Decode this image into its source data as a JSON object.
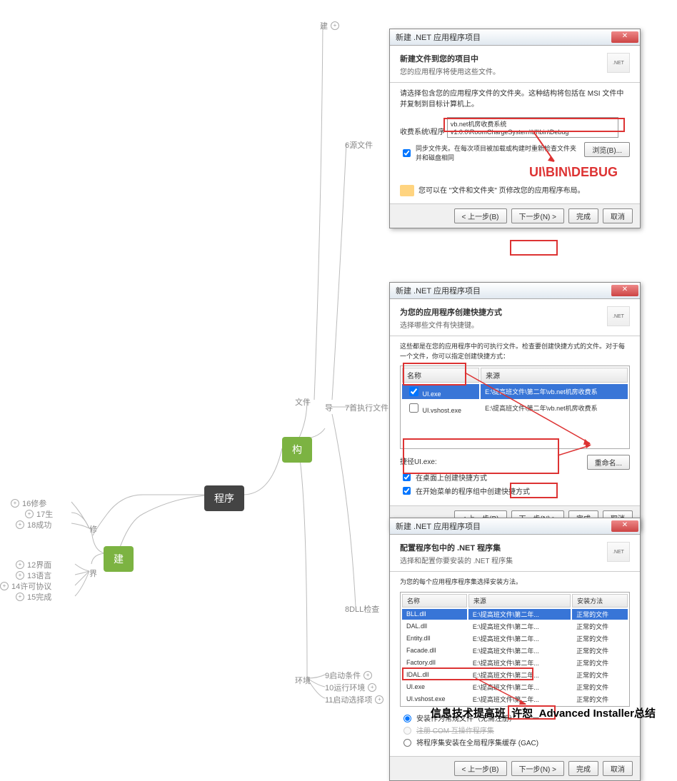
{
  "mind": {
    "root": "程序",
    "build": "建",
    "gou": "构",
    "wenjing": "文件",
    "dao": "导",
    "huanjing": "环境",
    "xiu": "修",
    "jie": "界",
    "jian": "建",
    "n6": "6源文件",
    "n7": "7首执行文件",
    "n8": "8DLL检查",
    "n9": "9启动条件",
    "n10": "10运行环境",
    "n11": "11启动选择项",
    "n12": "12界面",
    "n13": "13语言",
    "n14": "14许可协议",
    "n15": "15完成",
    "n16": "16修参",
    "n17": "17生",
    "n18": "18成功",
    "top_jian": "建"
  },
  "dlg1": {
    "title": "新建 .NET 应用程序项目",
    "head": "新建文件到您的项目中",
    "sub": "您的应用程序将使用这些文件。",
    "info": "请选择包含您的应用程序文件的文件夹。这种结构将包括在 MSI 文件中并复制到目标计算机上。",
    "label": "收费系统\\程序",
    "path": "vb.net机房收费系统v1.0.0\\RoomChargeSystem\\UI\\bin\\Debug",
    "sync": "同步文件夹。在每次项目被加载或构建时重新检查文件夹并和磁盘相同",
    "browse": "浏览(B)...",
    "tip": "您可以在 \"文件和文件夹\" 页修改您的应用程序布局。",
    "red": "UI\\BIN\\DEBUG",
    "back": "< 上一步(B)",
    "next": "下一步(N) >",
    "finish": "完成",
    "cancel": "取消"
  },
  "dlg2": {
    "title": "新建 .NET 应用程序项目",
    "head": "为您的应用程序创建快捷方式",
    "sub": "选择哪些文件有快捷键。",
    "info": "这些都是在您的应用程序中的可执行文件。检查要创建快捷方式的文件。对于每一个文件，你可以指定创建快捷方式：",
    "col1": "名称",
    "col2": "来源",
    "r1": {
      "n": "UI.exe",
      "s": "E:\\提高班文件\\第二年\\vb.net机房收费系"
    },
    "r2": {
      "n": "UI.vshost.exe",
      "s": "E:\\提高班文件\\第二年\\vb.net机房收费系"
    },
    "shortcut": "捷径UI.exe:",
    "rename": "重命名...",
    "c1": "在桌面上创建快捷方式",
    "c2": "在开始菜单的程序组中创建快捷方式",
    "back": "< 上一步(B)",
    "next": "下一步(N) >",
    "finish": "完成",
    "cancel": "取消"
  },
  "dlg3": {
    "title": "新建 .NET 应用程序项目",
    "head": "配置程序包中的 .NET 程序集",
    "sub": "选择和配置你要安装的 .NET 程序集",
    "info": "为您的每个应用程序程序集选择安装方法。",
    "col1": "名称",
    "col2": "来源",
    "col3": "安装方法",
    "rows": [
      {
        "n": "BLL.dll",
        "s": "E:\\提高班文件\\第二年...",
        "m": "正常的文件"
      },
      {
        "n": "DAL.dll",
        "s": "E:\\提高班文件\\第二年...",
        "m": "正常的文件"
      },
      {
        "n": "Entity.dll",
        "s": "E:\\提高班文件\\第二年...",
        "m": "正常的文件"
      },
      {
        "n": "Facade.dll",
        "s": "E:\\提高班文件\\第二年...",
        "m": "正常的文件"
      },
      {
        "n": "Factory.dll",
        "s": "E:\\提高班文件\\第二年...",
        "m": "正常的文件"
      },
      {
        "n": "IDAL.dll",
        "s": "E:\\提高班文件\\第二年...",
        "m": "正常的文件"
      },
      {
        "n": "UI.exe",
        "s": "E:\\提高班文件\\第二年...",
        "m": "正常的文件"
      },
      {
        "n": "UI.vshost.exe",
        "s": "E:\\提高班文件\\第二年...",
        "m": "正常的文件"
      }
    ],
    "opt1": "安装作为常规文件（无需注册）",
    "opt2": "注册 COM 互操作程序集",
    "opt3": "将程序集安装在全局程序集缓存 (GAC)",
    "back": "< 上一步(B)",
    "next": "下一步(N) >",
    "finish": "完成",
    "cancel": "取消"
  },
  "footer": "信息技术提高班_许恕_Advanced Installer总结"
}
